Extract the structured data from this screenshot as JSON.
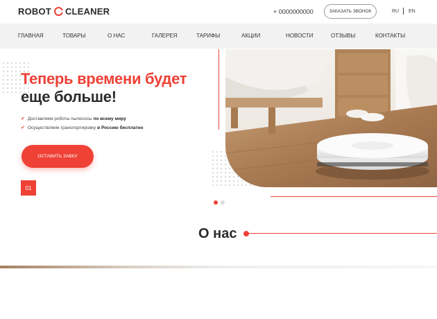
{
  "header": {
    "logo_left": "ROBOT",
    "logo_right": "CLEANER",
    "phone": "+ 0000000000",
    "callback_label": "ЗАКАЗАТЬ ЗВОНОК",
    "lang_ru": "RU",
    "lang_en": "EN"
  },
  "nav": {
    "items": [
      "ГЛАВНАЯ",
      "ТОВАРЫ",
      "О НАС",
      "ГАЛЕРЕЯ",
      "ТАРИФЫ",
      "АКЦИИ",
      "НОВОСТИ",
      "ОТЗЫВЫ",
      "КОНТАКТЫ"
    ]
  },
  "hero": {
    "title_line1": "Теперь времени будет",
    "title_line2": "еще больше!",
    "bullets": [
      {
        "text": "Доставляем роботы пылесосы",
        "bold": "по всему миру"
      },
      {
        "text": "Осуществляем транспортировку",
        "bold": "в Россию бесплатно"
      }
    ],
    "cta_label": "ОСТАВИТЬ ЗАВКУ",
    "slide_number": "01",
    "slider_active_index": 0,
    "slider_count": 2
  },
  "about": {
    "title": "О нас"
  },
  "colors": {
    "accent": "#ef4136",
    "text_dark": "#2b2b2b",
    "nav_bg": "#f2f2f2"
  }
}
